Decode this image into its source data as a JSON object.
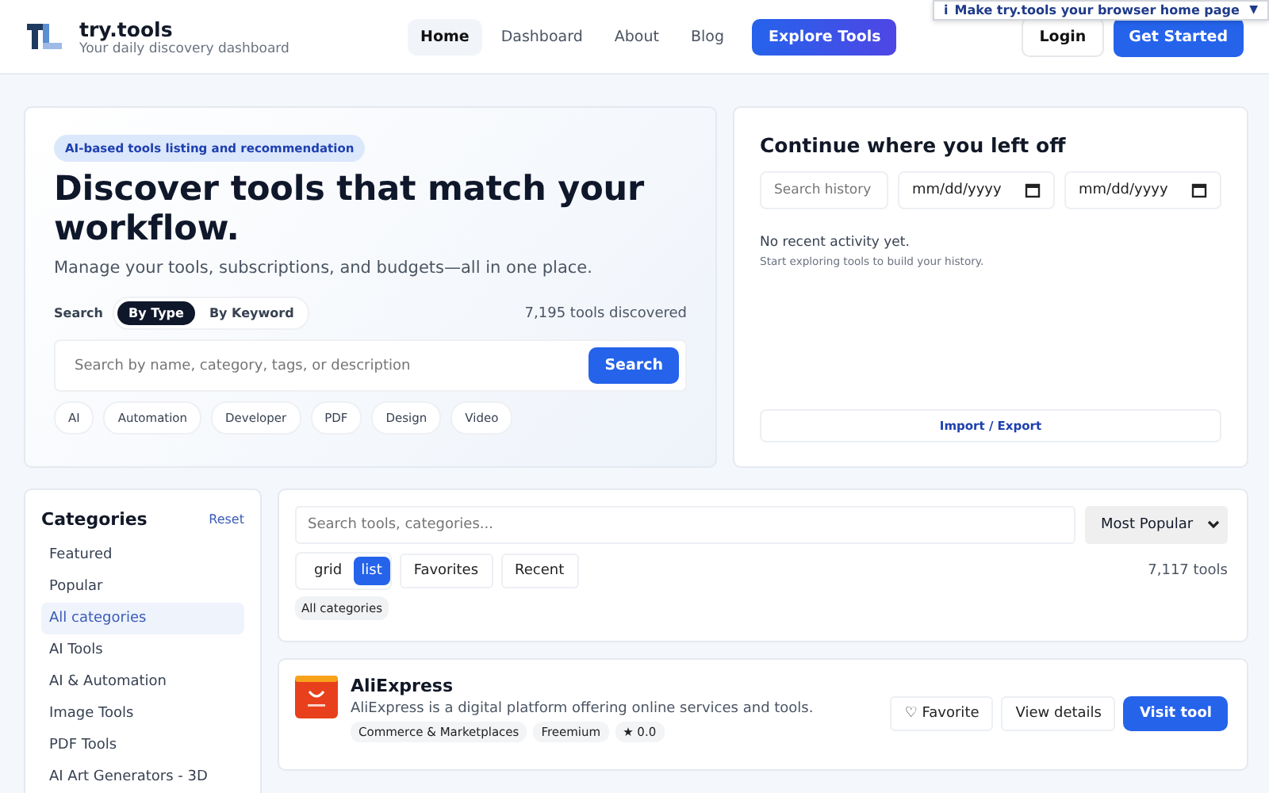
{
  "brand": {
    "name": "try.tools",
    "tagline": "Your daily discovery dashboard"
  },
  "nav": [
    {
      "label": "Home",
      "selected": true
    },
    {
      "label": "Dashboard",
      "selected": false
    },
    {
      "label": "About",
      "selected": false
    },
    {
      "label": "Blog",
      "selected": false
    }
  ],
  "explore_button": "Explore Tools",
  "login_button": "Login",
  "get_started_button": "Get Started",
  "homepage_banner": {
    "icon": "i",
    "text": "Make try.tools your browser home page",
    "caret": "▼"
  },
  "hero": {
    "badge": "AI-based tools listing and recommendation",
    "title": "Discover tools that match your workflow.",
    "subtitle": "Manage your tools, subscriptions, and budgets—all in one place.",
    "search_label": "Search",
    "modes": [
      {
        "label": "By Type",
        "selected": true
      },
      {
        "label": "By Keyword",
        "selected": false
      }
    ],
    "count": "7,195 tools discovered",
    "search": {
      "placeholder": "Search by name, category, tags, or description"
    },
    "search_button": "Search",
    "chips": [
      "AI",
      "Automation",
      "Developer",
      "PDF",
      "Design",
      "Video"
    ]
  },
  "history": {
    "title": "Continue where you left off",
    "search": {
      "placeholder": "Search history"
    },
    "dates": [
      "mm/dd/yyyy",
      "mm/dd/yyyy"
    ],
    "empty": "No recent activity yet.",
    "hint": "Start exploring tools to build your history.",
    "import_export": "Import / Export"
  },
  "sidebar": {
    "title": "Categories",
    "reset": "Reset",
    "items": [
      {
        "label": "Featured",
        "selected": false
      },
      {
        "label": "Popular",
        "selected": false
      },
      {
        "label": "All categories",
        "selected": true
      },
      {
        "label": "AI Tools",
        "selected": false
      },
      {
        "label": "AI & Automation",
        "selected": false
      },
      {
        "label": "Image Tools",
        "selected": false
      },
      {
        "label": "PDF Tools",
        "selected": false
      },
      {
        "label": "AI Art Generators - 3D",
        "selected": false
      }
    ]
  },
  "filters": {
    "search": {
      "placeholder": "Search tools, categories..."
    },
    "sort": "Most Popular",
    "views": [
      {
        "label": "grid",
        "selected": false
      },
      {
        "label": "list",
        "selected": true
      }
    ],
    "toggles": [
      "Favorites",
      "Recent"
    ],
    "count": "7,117 tools",
    "active_filter": "All categories"
  },
  "tools": [
    {
      "name": "AliExpress",
      "description": "AliExpress is a digital platform offering online services and tools.",
      "tags": [
        "Commerce & Marketplaces",
        "Freemium"
      ],
      "rating": "★ 0.0",
      "favorite_button": "♡ Favorite",
      "details_button": "View details",
      "visit_button": "Visit tool"
    }
  ]
}
